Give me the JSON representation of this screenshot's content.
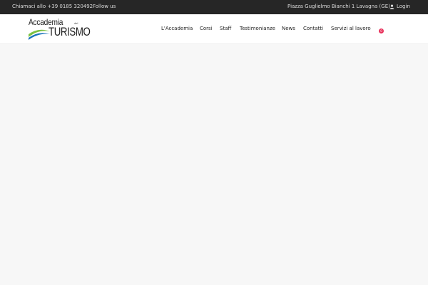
{
  "topbar": {
    "phone": "Chiamaci allo +39 0185 320492",
    "follow": "Follow us",
    "address": "Piazza Guglielmo Bianchi 1 Lavagna (GE)",
    "login": "Login"
  },
  "logo": {
    "line1": "Accademia",
    "small": "del",
    "line2": "TURISMO"
  },
  "nav": {
    "items": [
      "L'Accademia",
      "Corsi",
      "Staff",
      "Testimonianze",
      "News",
      "Contatti",
      "Servizi al lavoro"
    ]
  },
  "cart": {
    "count": "0"
  },
  "colors": {
    "topbar_bg": "#262626",
    "accent": "#e8315b",
    "logo_green": "#7cc242",
    "logo_blue": "#1b75bc"
  }
}
